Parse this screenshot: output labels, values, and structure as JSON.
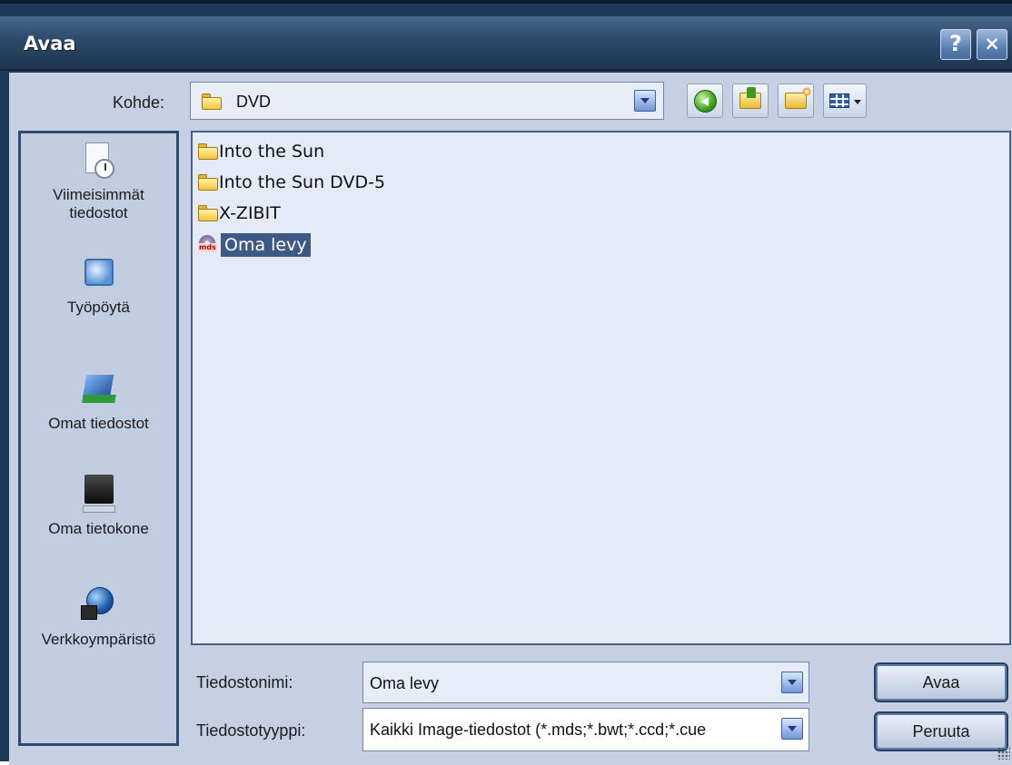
{
  "window": {
    "title": "Avaa",
    "help_glyph": "?",
    "close_glyph": "×"
  },
  "location": {
    "label": "Kohde:",
    "value": "DVD",
    "icon": "folder-icon"
  },
  "toolbar": {
    "icons": [
      "back-icon",
      "up-folder-icon",
      "new-folder-icon",
      "view-menu-icon"
    ]
  },
  "places": [
    {
      "label_line1": "Viimeisimmät",
      "label_line2": "tiedostot",
      "icon": "recent-documents-icon"
    },
    {
      "label_line1": "Työpöytä",
      "label_line2": "",
      "icon": "desktop-icon"
    },
    {
      "label_line1": "Omat tiedostot",
      "label_line2": "",
      "icon": "my-documents-icon"
    },
    {
      "label_line1": "Oma tietokone",
      "label_line2": "",
      "icon": "my-computer-icon"
    },
    {
      "label_line1": "Verkkoympäristö",
      "label_line2": "",
      "icon": "network-icon"
    }
  ],
  "files": [
    {
      "name": "Into the Sun",
      "type": "folder",
      "selected": false
    },
    {
      "name": "Into the Sun DVD-5",
      "type": "folder",
      "selected": false
    },
    {
      "name": "X-ZIBIT",
      "type": "folder",
      "selected": false
    },
    {
      "name": "Oma levy",
      "type": "mds",
      "selected": true,
      "icon_text": "mds"
    }
  ],
  "filename": {
    "label": "Tiedostonimi:",
    "value": "Oma levy"
  },
  "filetype": {
    "label": "Tiedostotyyppi:",
    "value": "Kaikki Image-tiedostot (*.mds;*.bwt;*.ccd;*.cue"
  },
  "buttons": {
    "open": "Avaa",
    "cancel": "Peruuta"
  }
}
